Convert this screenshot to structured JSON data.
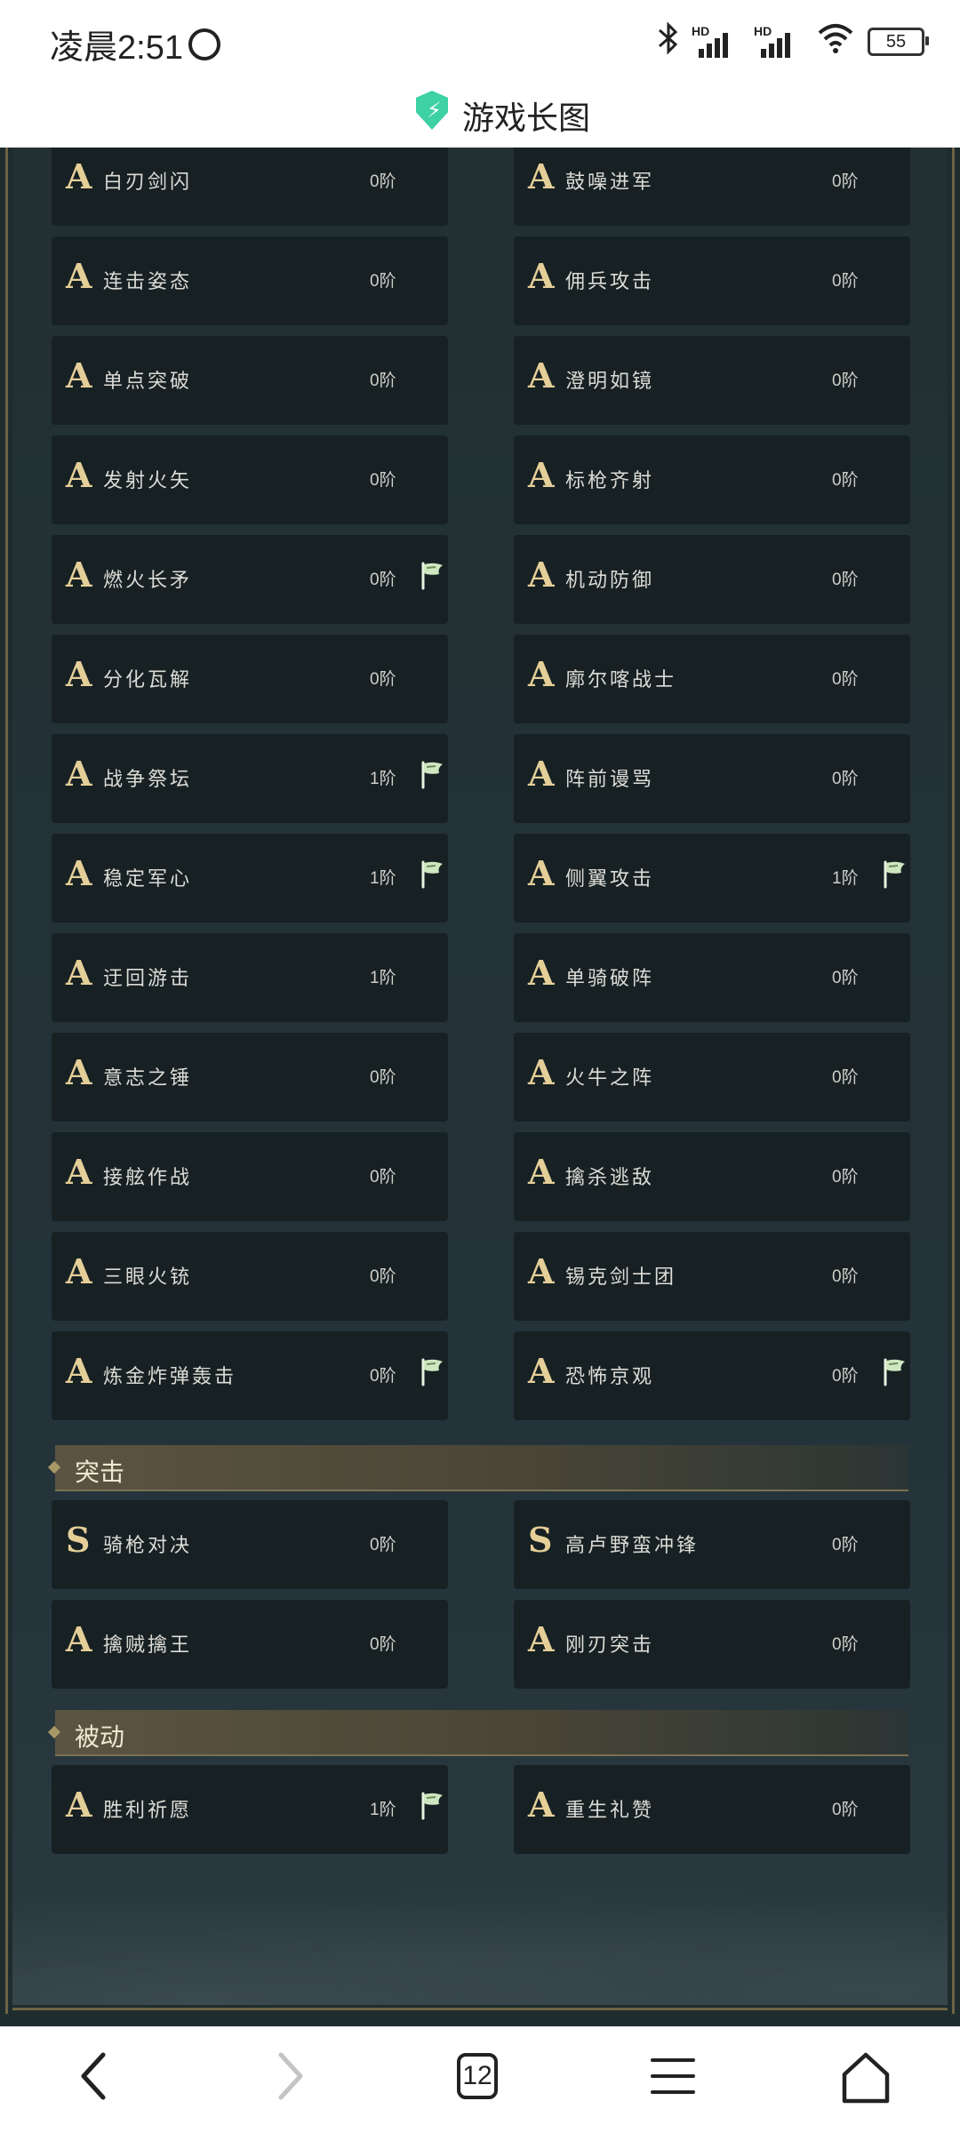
{
  "status_bar": {
    "time": "凌晨2:51",
    "signal1_label": "HD",
    "signal2_label": "HD",
    "battery": "55"
  },
  "title_bar": {
    "title": "游戏长图"
  },
  "skills_a": [
    {
      "grade": "A",
      "name": "白刃剑闪",
      "level": "0阶",
      "flag": false
    },
    {
      "grade": "A",
      "name": "鼓噪进军",
      "level": "0阶",
      "flag": false
    },
    {
      "grade": "A",
      "name": "连击姿态",
      "level": "0阶",
      "flag": false
    },
    {
      "grade": "A",
      "name": "佣兵攻击",
      "level": "0阶",
      "flag": false
    },
    {
      "grade": "A",
      "name": "单点突破",
      "level": "0阶",
      "flag": false
    },
    {
      "grade": "A",
      "name": "澄明如镜",
      "level": "0阶",
      "flag": false
    },
    {
      "grade": "A",
      "name": "发射火矢",
      "level": "0阶",
      "flag": false
    },
    {
      "grade": "A",
      "name": "标枪齐射",
      "level": "0阶",
      "flag": false
    },
    {
      "grade": "A",
      "name": "燃火长矛",
      "level": "0阶",
      "flag": true
    },
    {
      "grade": "A",
      "name": "机动防御",
      "level": "0阶",
      "flag": false
    },
    {
      "grade": "A",
      "name": "分化瓦解",
      "level": "0阶",
      "flag": false
    },
    {
      "grade": "A",
      "name": "廓尔喀战士",
      "level": "0阶",
      "flag": false
    },
    {
      "grade": "A",
      "name": "战争祭坛",
      "level": "1阶",
      "flag": true
    },
    {
      "grade": "A",
      "name": "阵前谩骂",
      "level": "0阶",
      "flag": false
    },
    {
      "grade": "A",
      "name": "稳定军心",
      "level": "1阶",
      "flag": true
    },
    {
      "grade": "A",
      "name": "侧翼攻击",
      "level": "1阶",
      "flag": true
    },
    {
      "grade": "A",
      "name": "迂回游击",
      "level": "1阶",
      "flag": false
    },
    {
      "grade": "A",
      "name": "单骑破阵",
      "level": "0阶",
      "flag": false
    },
    {
      "grade": "A",
      "name": "意志之锤",
      "level": "0阶",
      "flag": false
    },
    {
      "grade": "A",
      "name": "火牛之阵",
      "level": "0阶",
      "flag": false
    },
    {
      "grade": "A",
      "name": "接舷作战",
      "level": "0阶",
      "flag": false
    },
    {
      "grade": "A",
      "name": "擒杀逃敌",
      "level": "0阶",
      "flag": false
    },
    {
      "grade": "A",
      "name": "三眼火铳",
      "level": "0阶",
      "flag": false
    },
    {
      "grade": "A",
      "name": "锡克剑士团",
      "level": "0阶",
      "flag": false
    },
    {
      "grade": "A",
      "name": "炼金炸弹轰击",
      "level": "0阶",
      "flag": true
    },
    {
      "grade": "A",
      "name": "恐怖京观",
      "level": "0阶",
      "flag": true
    }
  ],
  "section_tuji": {
    "title": "突击",
    "items": [
      {
        "grade": "S",
        "name": "骑枪对决",
        "level": "0阶",
        "flag": false
      },
      {
        "grade": "S",
        "name": "高卢野蛮冲锋",
        "level": "0阶",
        "flag": false
      },
      {
        "grade": "A",
        "name": "擒贼擒王",
        "level": "0阶",
        "flag": false
      },
      {
        "grade": "A",
        "name": "刚刃突击",
        "level": "0阶",
        "flag": false
      }
    ]
  },
  "section_beidong": {
    "title": "被动",
    "items": [
      {
        "grade": "A",
        "name": "胜利祈愿",
        "level": "1阶",
        "flag": true
      },
      {
        "grade": "A",
        "name": "重生礼赞",
        "level": "0阶",
        "flag": false
      }
    ]
  },
  "nav_bar": {
    "tabs_count": "12"
  },
  "colors": {
    "card_bg": "#172124",
    "grade_gold": "#e5cf98",
    "flag_green": "#cfe7c0",
    "title_shield": "#3dd1a3"
  },
  "icons": [
    "alarm-icon",
    "bluetooth-icon",
    "signal-icon",
    "wifi-icon",
    "battery-icon",
    "shield-icon",
    "flag-icon",
    "back-icon",
    "forward-icon",
    "tabs-icon",
    "menu-icon",
    "home-icon"
  ]
}
